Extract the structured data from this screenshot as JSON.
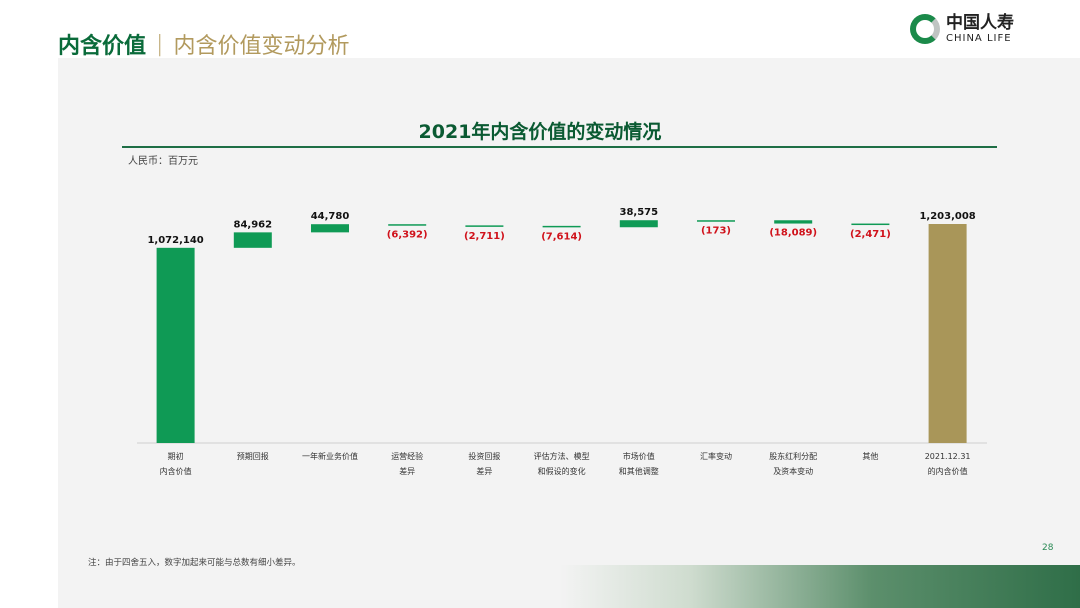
{
  "header": {
    "section": "内含价值",
    "separator": "|",
    "subtitle": "内含价值变动分析"
  },
  "logo": {
    "cn": "中国人寿",
    "en": "CHINA LIFE"
  },
  "page_number": "28",
  "footnote": "注：由于四舍五入，数字加起来可能与总数有细小差异。",
  "colors": {
    "green": "#0f9a55",
    "gold": "#a99659",
    "negative": "#d0121b"
  },
  "chart_data": {
    "type": "waterfall",
    "title": "2021年内含价值的变动情况",
    "unit_label": "人民币：百万元",
    "categories": [
      [
        "期初",
        "内含价值"
      ],
      [
        "预期回报"
      ],
      [
        "一年新业务价值"
      ],
      [
        "运营经验",
        "差异"
      ],
      [
        "投资回报",
        "差异"
      ],
      [
        "评估方法、模型",
        "和假设的变化"
      ],
      [
        "市场价值",
        "和其他调整"
      ],
      [
        "汇率变动"
      ],
      [
        "股东红利分配",
        "及资本变动"
      ],
      [
        "其他"
      ],
      [
        "2021.12.31",
        "的内含价值"
      ]
    ],
    "values": [
      1072140,
      84962,
      44780,
      -6392,
      -2711,
      -7614,
      38575,
      -173,
      -18089,
      -2471,
      1203008
    ],
    "labels": [
      "1,072,140",
      "84,962",
      "44,780",
      "(6,392)",
      "(2,711)",
      "(7,614)",
      "38,575",
      "(173)",
      "(18,089)",
      "(2,471)",
      "1,203,008"
    ],
    "kinds": [
      "total",
      "delta",
      "delta",
      "delta",
      "delta",
      "delta",
      "delta",
      "delta",
      "delta",
      "delta",
      "total"
    ],
    "ylim": [
      0,
      1203008
    ]
  }
}
